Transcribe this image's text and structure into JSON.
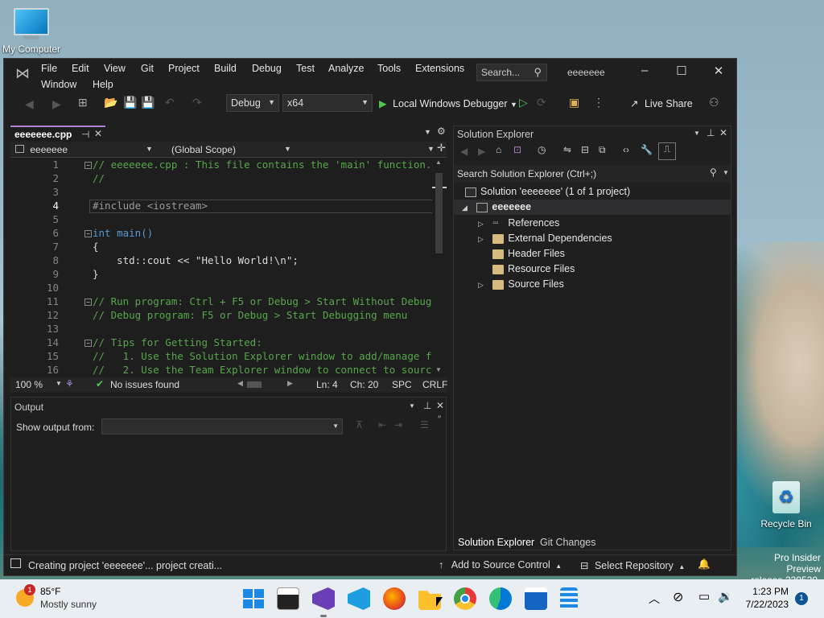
{
  "desktop": {
    "my_computer": "My Computer",
    "recycle_bin": "Recycle Bin",
    "watermark_line1": "Pro Insider Preview",
    "watermark_line2": "release.230520-1632"
  },
  "menu": {
    "items": [
      "File",
      "Edit",
      "View",
      "Git",
      "Project",
      "Build",
      "Debug",
      "Test",
      "Analyze",
      "Tools",
      "Extensions",
      "Window",
      "Help"
    ],
    "search_placeholder": "Search...",
    "solution_name": "eeeeeee"
  },
  "toolbar": {
    "config": "Debug",
    "platform": "x64",
    "debugger": "Local Windows Debugger",
    "live_share": "Live Share"
  },
  "editor": {
    "tab_label": "eeeeeee.cpp",
    "project_combo": "eeeeeee",
    "scope_combo": "(Global Scope)",
    "lines": [
      {
        "n": "1",
        "t": "// eeeeeee.cpp : This file contains the 'main' function."
      },
      {
        "n": "2",
        "t": "//"
      },
      {
        "n": "3",
        "t": ""
      },
      {
        "n": "4",
        "t": "#include <iostream>"
      },
      {
        "n": "5",
        "t": ""
      },
      {
        "n": "6",
        "t": "int main()"
      },
      {
        "n": "7",
        "t": "{"
      },
      {
        "n": "8",
        "t": "    std::cout << \"Hello World!\\n\";"
      },
      {
        "n": "9",
        "t": "}"
      },
      {
        "n": "10",
        "t": ""
      },
      {
        "n": "11",
        "t": "// Run program: Ctrl + F5 or Debug > Start Without Debugg"
      },
      {
        "n": "12",
        "t": "// Debug program: F5 or Debug > Start Debugging menu"
      },
      {
        "n": "13",
        "t": ""
      },
      {
        "n": "14",
        "t": "// Tips for Getting Started:"
      },
      {
        "n": "15",
        "t": "//   1. Use the Solution Explorer window to add/manage f"
      },
      {
        "n": "16",
        "t": "//   2. Use the Team Explorer window to connect to sourc"
      }
    ],
    "zoom": "100 %",
    "issues": "No issues found",
    "ln": "Ln: 4",
    "ch": "Ch: 20",
    "spc": "SPC",
    "crlf": "CRLF"
  },
  "output": {
    "title": "Output",
    "show_from": "Show output from:"
  },
  "solution_explorer": {
    "title": "Solution Explorer",
    "search": "Search Solution Explorer (Ctrl+;)",
    "solution": "Solution 'eeeeeee' (1 of 1 project)",
    "project": "eeeeeee",
    "items": [
      "References",
      "External Dependencies",
      "Header Files",
      "Resource Files",
      "Source Files"
    ],
    "tabs": [
      "Solution Explorer",
      "Git Changes"
    ]
  },
  "statusbar": {
    "message": "Creating project 'eeeeeee'... project creati...",
    "source_control": "Add to Source Control",
    "repository": "Select Repository"
  },
  "taskbar": {
    "temp": "85°F",
    "weather": "Mostly sunny",
    "weather_badge": "1",
    "time": "1:23 PM",
    "date": "7/22/2023",
    "notif": "1"
  }
}
